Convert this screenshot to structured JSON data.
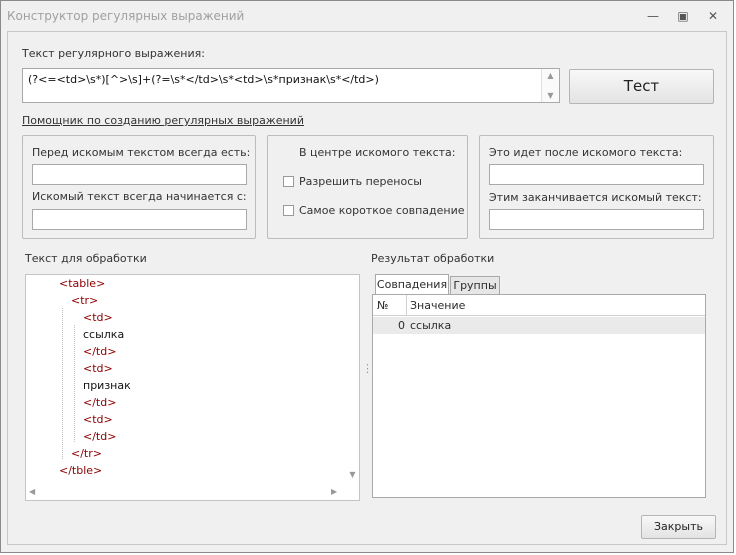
{
  "window": {
    "title": "Конструктор регулярных выражений",
    "minimize_glyph": "—",
    "maximize_glyph": "▣",
    "close_glyph": "✕"
  },
  "regex": {
    "label": "Текст регулярного выражения:",
    "value": "(?<=<td>\\s*)[^>\\s]+(?=\\s*</td>\\s*<td>\\s*признак\\s*</td>)"
  },
  "test_button": "Тест",
  "helper_link": "Помощник по созданию регулярных выражений",
  "before": {
    "label_before": "Перед искомым текстом всегда есть:",
    "value_before": "",
    "label_starts": "Искомый текст всегда начинается с:",
    "value_starts": ""
  },
  "center": {
    "title": "В центре искомого текста:",
    "allow_breaks": "Разрешить переносы",
    "shortest": "Самое короткое совпадение"
  },
  "after": {
    "label_after": "Это идет после искомого текста:",
    "value_after": "",
    "label_ends": "Этим заканчивается искомый текст:",
    "value_ends": ""
  },
  "source": {
    "label": "Текст для обработки",
    "lines": [
      {
        "text": "<table>",
        "indent": 0,
        "type": "tag"
      },
      {
        "text": "<tr>",
        "indent": 1,
        "type": "tag"
      },
      {
        "text": "<td>",
        "indent": 2,
        "type": "tag"
      },
      {
        "text": "ссылка",
        "indent": 2,
        "type": "text"
      },
      {
        "text": "</td>",
        "indent": 2,
        "type": "tag"
      },
      {
        "text": "<td>",
        "indent": 2,
        "type": "tag"
      },
      {
        "text": "признак",
        "indent": 2,
        "type": "text"
      },
      {
        "text": "</td>",
        "indent": 2,
        "type": "tag"
      },
      {
        "text": "<td>",
        "indent": 2,
        "type": "tag"
      },
      {
        "text": "</td>",
        "indent": 2,
        "type": "tag"
      },
      {
        "text": "</tr>",
        "indent": 1,
        "type": "tag"
      },
      {
        "text": "</tble>",
        "indent": 0,
        "type": "tag"
      }
    ]
  },
  "result": {
    "label": "Результат обработки",
    "tabs": [
      "Совпадения",
      "Группы"
    ],
    "columns": [
      "№",
      "Значение"
    ],
    "rows": [
      {
        "num": "0",
        "value": "ссылка"
      }
    ]
  },
  "close_button": "Закрыть",
  "colors": {
    "tag": "#8b0000",
    "selected_row": "#eaeaea"
  }
}
